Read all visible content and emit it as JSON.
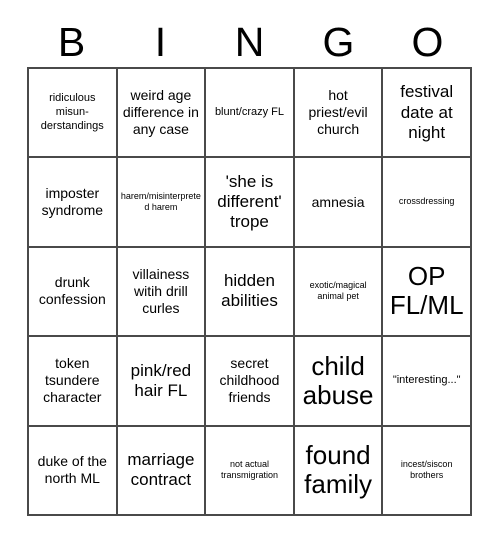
{
  "card": {
    "title": "BINGO",
    "header_letters": [
      "B",
      "I",
      "N",
      "G",
      "O"
    ],
    "colors": {
      "background": "#ffffff",
      "text": "#000000",
      "grid_line": "#4a4a4a"
    },
    "grid": {
      "columns": 5,
      "rows": 5,
      "cells": [
        {
          "text": "ridiculous misun-derstandings",
          "size": "sm"
        },
        {
          "text": "weird age difference in any case",
          "size": "md"
        },
        {
          "text": "blunt/crazy FL",
          "size": "sm"
        },
        {
          "text": "hot priest/evil church",
          "size": "md"
        },
        {
          "text": "festival date at night",
          "size": "lg"
        },
        {
          "text": "imposter syndrome",
          "size": "md"
        },
        {
          "text": "harem/misinterpreted harem",
          "size": "xs"
        },
        {
          "text": "'she is different' trope",
          "size": "lg"
        },
        {
          "text": "amnesia",
          "size": "md"
        },
        {
          "text": "crossdressing",
          "size": "xs"
        },
        {
          "text": "drunk confession",
          "size": "md"
        },
        {
          "text": "villainess witih drill curles",
          "size": "md"
        },
        {
          "text": "hidden abilities",
          "size": "lg"
        },
        {
          "text": "exotic/magical animal pet",
          "size": "xs"
        },
        {
          "text": "OP FL/ML",
          "size": "xxl"
        },
        {
          "text": "token tsundere character",
          "size": "md"
        },
        {
          "text": "pink/red hair FL",
          "size": "lg"
        },
        {
          "text": "secret childhood friends",
          "size": "md"
        },
        {
          "text": "child abuse",
          "size": "xxl"
        },
        {
          "text": "\"interesting...\"",
          "size": "sm"
        },
        {
          "text": "duke of the north ML",
          "size": "md"
        },
        {
          "text": "marriage contract",
          "size": "lg"
        },
        {
          "text": "not actual transmigration",
          "size": "xs"
        },
        {
          "text": "found family",
          "size": "xxl"
        },
        {
          "text": "incest/siscon brothers",
          "size": "xs"
        }
      ]
    }
  }
}
